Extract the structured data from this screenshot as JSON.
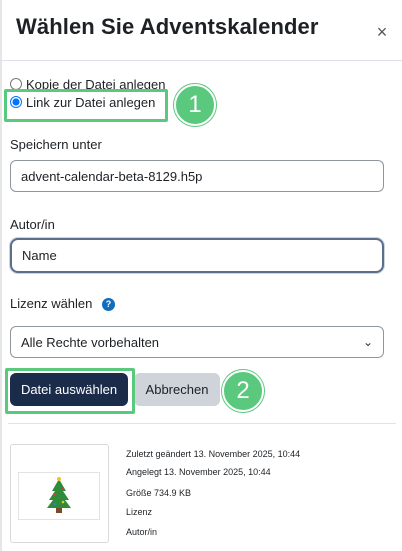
{
  "dialog": {
    "title": "Wählen Sie Adventskalender",
    "close_icon": "×"
  },
  "options": {
    "copy_label": "Kopie der Datei anlegen",
    "link_label": "Link zur Datei anlegen",
    "selected": "link"
  },
  "save_as": {
    "label": "Speichern unter",
    "value": "advent-calendar-beta-8129.h5p"
  },
  "author": {
    "label": "Autor/in",
    "value": "Name"
  },
  "license": {
    "label": "Lizenz wählen",
    "help_icon": "?",
    "selected": "Alle Rechte vorbehalten",
    "chevron": "⌄"
  },
  "buttons": {
    "select_file": "Datei auswählen",
    "cancel": "Abbrechen"
  },
  "badges": [
    "1",
    "2"
  ],
  "file_info": {
    "modified_label": "Zuletzt geändert",
    "modified_value": "13. November 2025, 10:44",
    "created_label": "Angelegt",
    "created_value": "13. November 2025, 10:44",
    "size_label": "Größe",
    "size_value": "734.9 KB",
    "license_label": "Lizenz",
    "author_label": "Autor/in"
  },
  "colors": {
    "primary_button": "#1b2c4a",
    "highlight": "#5ac87d",
    "secondary_button": "#ced4da"
  }
}
